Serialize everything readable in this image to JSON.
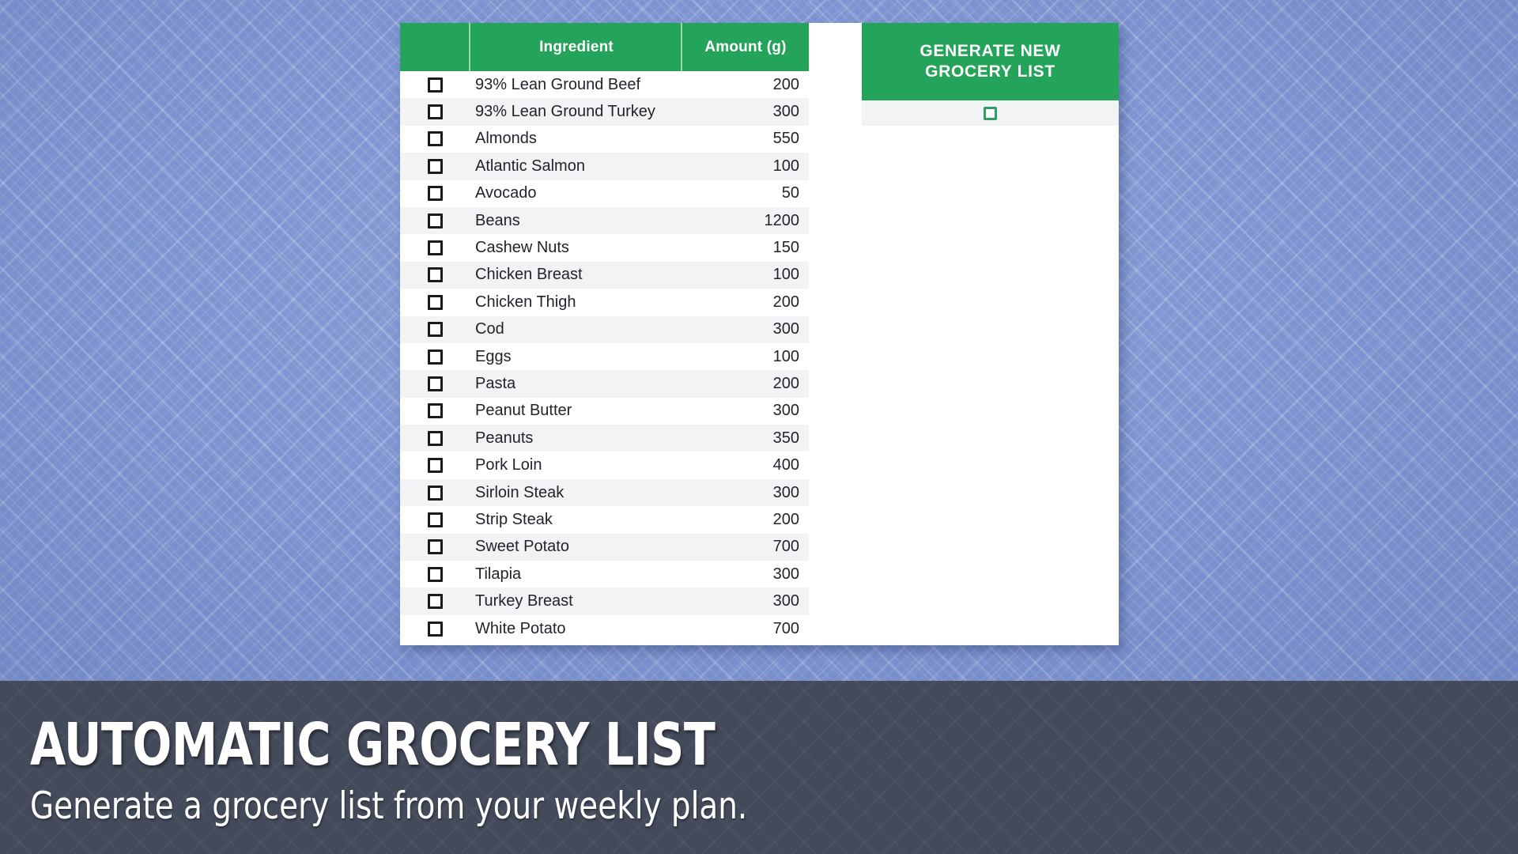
{
  "background": {
    "top_color": "#7e95d2",
    "banner_color": "#434a5a",
    "accent_green": "#24a35a"
  },
  "card": {
    "table": {
      "columns": [
        {
          "key": "check",
          "label": ""
        },
        {
          "key": "name",
          "label": "Ingredient"
        },
        {
          "key": "amount",
          "label": "Amount (g)"
        }
      ],
      "rows": [
        {
          "check": "unchecked",
          "name": "93% Lean Ground Beef",
          "amount": "200"
        },
        {
          "check": "unchecked",
          "name": "93% Lean Ground Turkey",
          "amount": "300"
        },
        {
          "check": "unchecked",
          "name": "Almonds",
          "amount": "550"
        },
        {
          "check": "unchecked",
          "name": "Atlantic Salmon",
          "amount": "100"
        },
        {
          "check": "unchecked",
          "name": "Avocado",
          "amount": "50"
        },
        {
          "check": "unchecked",
          "name": "Beans",
          "amount": "1200"
        },
        {
          "check": "unchecked",
          "name": "Cashew Nuts",
          "amount": "150"
        },
        {
          "check": "unchecked",
          "name": "Chicken Breast",
          "amount": "100"
        },
        {
          "check": "unchecked",
          "name": "Chicken Thigh",
          "amount": "200"
        },
        {
          "check": "unchecked",
          "name": "Cod",
          "amount": "300"
        },
        {
          "check": "unchecked",
          "name": "Eggs",
          "amount": "100"
        },
        {
          "check": "unchecked",
          "name": "Pasta",
          "amount": "200"
        },
        {
          "check": "unchecked",
          "name": "Peanut Butter",
          "amount": "300"
        },
        {
          "check": "unchecked",
          "name": "Peanuts",
          "amount": "350"
        },
        {
          "check": "unchecked",
          "name": "Pork Loin",
          "amount": "400"
        },
        {
          "check": "unchecked",
          "name": "Sirloin Steak",
          "amount": "300"
        },
        {
          "check": "unchecked",
          "name": "Strip Steak",
          "amount": "200"
        },
        {
          "check": "unchecked",
          "name": "Sweet Potato",
          "amount": "700"
        },
        {
          "check": "unchecked",
          "name": "Tilapia",
          "amount": "300"
        },
        {
          "check": "unchecked",
          "name": "Turkey Breast",
          "amount": "300"
        },
        {
          "check": "unchecked",
          "name": "White Potato",
          "amount": "700"
        }
      ]
    },
    "generate": {
      "label": "GENERATE NEW GROCERY LIST",
      "checkbox_state": "unchecked"
    }
  },
  "banner": {
    "title": "AUTOMATIC GROCERY LIST",
    "subtitle": "Generate a grocery list from your weekly plan."
  }
}
